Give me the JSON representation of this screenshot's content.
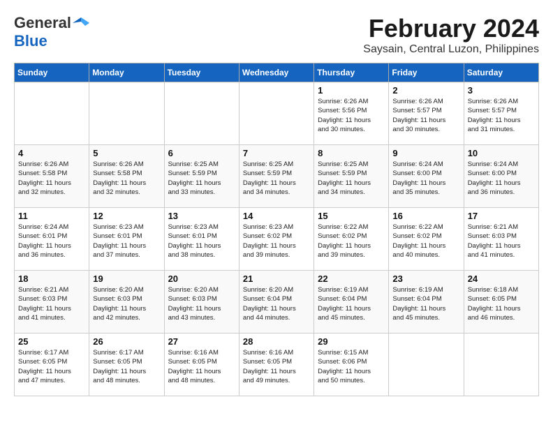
{
  "logo": {
    "line1": "General",
    "line2": "Blue"
  },
  "title": {
    "month_year": "February 2024",
    "location": "Saysain, Central Luzon, Philippines"
  },
  "headers": [
    "Sunday",
    "Monday",
    "Tuesday",
    "Wednesday",
    "Thursday",
    "Friday",
    "Saturday"
  ],
  "weeks": [
    [
      {
        "day": "",
        "info": ""
      },
      {
        "day": "",
        "info": ""
      },
      {
        "day": "",
        "info": ""
      },
      {
        "day": "",
        "info": ""
      },
      {
        "day": "1",
        "info": "Sunrise: 6:26 AM\nSunset: 5:56 PM\nDaylight: 11 hours\nand 30 minutes."
      },
      {
        "day": "2",
        "info": "Sunrise: 6:26 AM\nSunset: 5:57 PM\nDaylight: 11 hours\nand 30 minutes."
      },
      {
        "day": "3",
        "info": "Sunrise: 6:26 AM\nSunset: 5:57 PM\nDaylight: 11 hours\nand 31 minutes."
      }
    ],
    [
      {
        "day": "4",
        "info": "Sunrise: 6:26 AM\nSunset: 5:58 PM\nDaylight: 11 hours\nand 32 minutes."
      },
      {
        "day": "5",
        "info": "Sunrise: 6:26 AM\nSunset: 5:58 PM\nDaylight: 11 hours\nand 32 minutes."
      },
      {
        "day": "6",
        "info": "Sunrise: 6:25 AM\nSunset: 5:59 PM\nDaylight: 11 hours\nand 33 minutes."
      },
      {
        "day": "7",
        "info": "Sunrise: 6:25 AM\nSunset: 5:59 PM\nDaylight: 11 hours\nand 34 minutes."
      },
      {
        "day": "8",
        "info": "Sunrise: 6:25 AM\nSunset: 5:59 PM\nDaylight: 11 hours\nand 34 minutes."
      },
      {
        "day": "9",
        "info": "Sunrise: 6:24 AM\nSunset: 6:00 PM\nDaylight: 11 hours\nand 35 minutes."
      },
      {
        "day": "10",
        "info": "Sunrise: 6:24 AM\nSunset: 6:00 PM\nDaylight: 11 hours\nand 36 minutes."
      }
    ],
    [
      {
        "day": "11",
        "info": "Sunrise: 6:24 AM\nSunset: 6:01 PM\nDaylight: 11 hours\nand 36 minutes."
      },
      {
        "day": "12",
        "info": "Sunrise: 6:23 AM\nSunset: 6:01 PM\nDaylight: 11 hours\nand 37 minutes."
      },
      {
        "day": "13",
        "info": "Sunrise: 6:23 AM\nSunset: 6:01 PM\nDaylight: 11 hours\nand 38 minutes."
      },
      {
        "day": "14",
        "info": "Sunrise: 6:23 AM\nSunset: 6:02 PM\nDaylight: 11 hours\nand 39 minutes."
      },
      {
        "day": "15",
        "info": "Sunrise: 6:22 AM\nSunset: 6:02 PM\nDaylight: 11 hours\nand 39 minutes."
      },
      {
        "day": "16",
        "info": "Sunrise: 6:22 AM\nSunset: 6:02 PM\nDaylight: 11 hours\nand 40 minutes."
      },
      {
        "day": "17",
        "info": "Sunrise: 6:21 AM\nSunset: 6:03 PM\nDaylight: 11 hours\nand 41 minutes."
      }
    ],
    [
      {
        "day": "18",
        "info": "Sunrise: 6:21 AM\nSunset: 6:03 PM\nDaylight: 11 hours\nand 41 minutes."
      },
      {
        "day": "19",
        "info": "Sunrise: 6:20 AM\nSunset: 6:03 PM\nDaylight: 11 hours\nand 42 minutes."
      },
      {
        "day": "20",
        "info": "Sunrise: 6:20 AM\nSunset: 6:03 PM\nDaylight: 11 hours\nand 43 minutes."
      },
      {
        "day": "21",
        "info": "Sunrise: 6:20 AM\nSunset: 6:04 PM\nDaylight: 11 hours\nand 44 minutes."
      },
      {
        "day": "22",
        "info": "Sunrise: 6:19 AM\nSunset: 6:04 PM\nDaylight: 11 hours\nand 45 minutes."
      },
      {
        "day": "23",
        "info": "Sunrise: 6:19 AM\nSunset: 6:04 PM\nDaylight: 11 hours\nand 45 minutes."
      },
      {
        "day": "24",
        "info": "Sunrise: 6:18 AM\nSunset: 6:05 PM\nDaylight: 11 hours\nand 46 minutes."
      }
    ],
    [
      {
        "day": "25",
        "info": "Sunrise: 6:17 AM\nSunset: 6:05 PM\nDaylight: 11 hours\nand 47 minutes."
      },
      {
        "day": "26",
        "info": "Sunrise: 6:17 AM\nSunset: 6:05 PM\nDaylight: 11 hours\nand 48 minutes."
      },
      {
        "day": "27",
        "info": "Sunrise: 6:16 AM\nSunset: 6:05 PM\nDaylight: 11 hours\nand 48 minutes."
      },
      {
        "day": "28",
        "info": "Sunrise: 6:16 AM\nSunset: 6:05 PM\nDaylight: 11 hours\nand 49 minutes."
      },
      {
        "day": "29",
        "info": "Sunrise: 6:15 AM\nSunset: 6:06 PM\nDaylight: 11 hours\nand 50 minutes."
      },
      {
        "day": "",
        "info": ""
      },
      {
        "day": "",
        "info": ""
      }
    ]
  ]
}
